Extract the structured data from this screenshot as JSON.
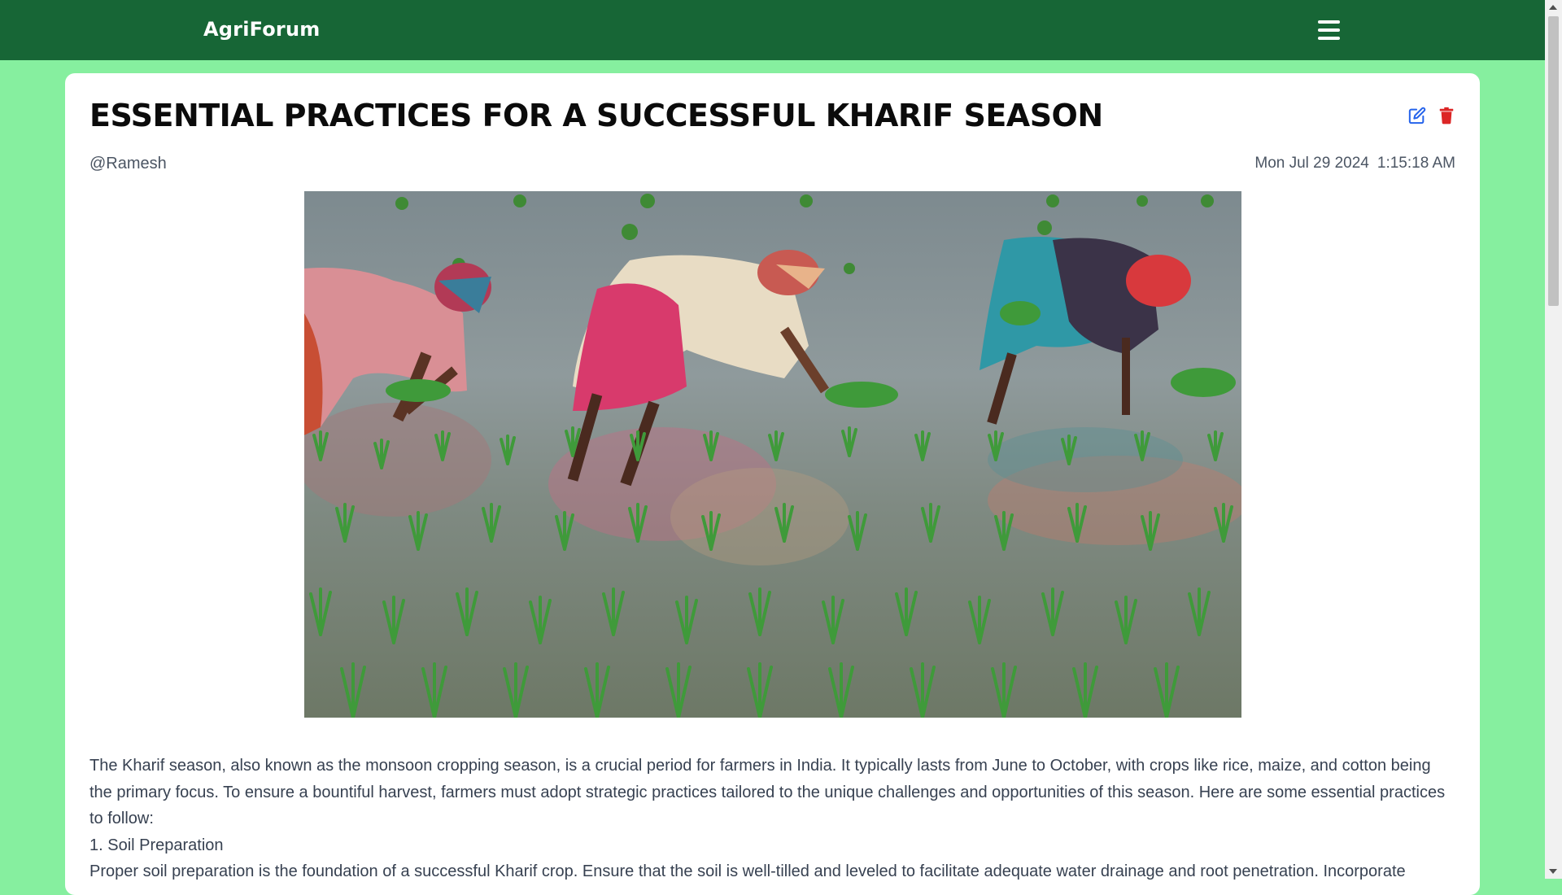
{
  "navbar": {
    "brand": "AgriForum",
    "menu_icon": "hamburger-menu-icon"
  },
  "post": {
    "title": "ESSENTIAL PRACTICES FOR A SUCCESSFUL KHARIF SEASON",
    "author": "@Ramesh",
    "date": "Mon Jul 29 2024",
    "time": "1:15:18 AM",
    "actions": {
      "edit_icon": "edit-icon",
      "delete_icon": "trash-icon",
      "edit_color": "#2563eb",
      "delete_color": "#dc2626"
    },
    "image": {
      "description_icon": "rice-paddy-photo"
    },
    "paragraphs": [
      "The Kharif season, also known as the monsoon cropping season, is a crucial period for farmers in India. It typically lasts from June to October, with crops like rice, maize, and cotton being the primary focus. To ensure a bountiful harvest, farmers must adopt strategic practices tailored to the unique challenges and opportunities of this season. Here are some essential practices to follow:",
      "1. Soil Preparation",
      "Proper soil preparation is the foundation of a successful Kharif crop. Ensure that the soil is well-tilled and leveled to facilitate adequate water drainage and root penetration. Incorporate"
    ]
  },
  "colors": {
    "navbar": "#176636",
    "page_background": "#86ef9f",
    "card": "#ffffff"
  }
}
